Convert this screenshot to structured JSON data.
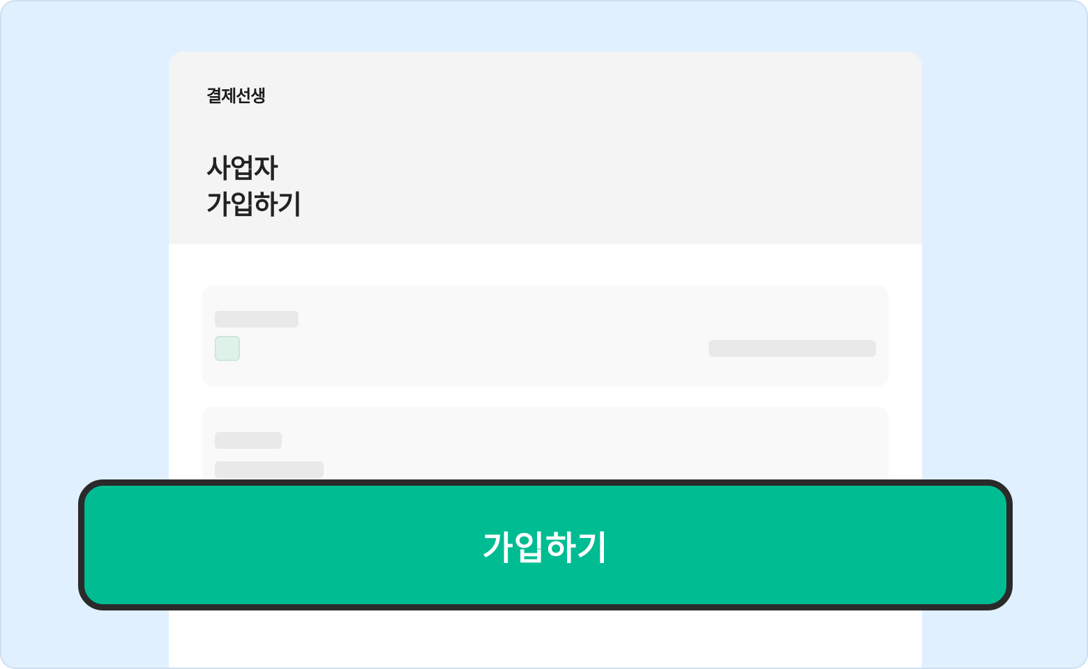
{
  "brand": {
    "name": "결제선생"
  },
  "signup": {
    "title_line1": "사업자",
    "title_line2": "가입하기"
  },
  "cta": {
    "label": "가입하기"
  },
  "colors": {
    "background": "#e0f0ff",
    "card_header": "#f4f4f4",
    "cta_fill": "#00bc92",
    "cta_border": "#2a2a2a",
    "skeleton": "#e9e9e9",
    "checkbox_fill": "#dff2ea"
  }
}
